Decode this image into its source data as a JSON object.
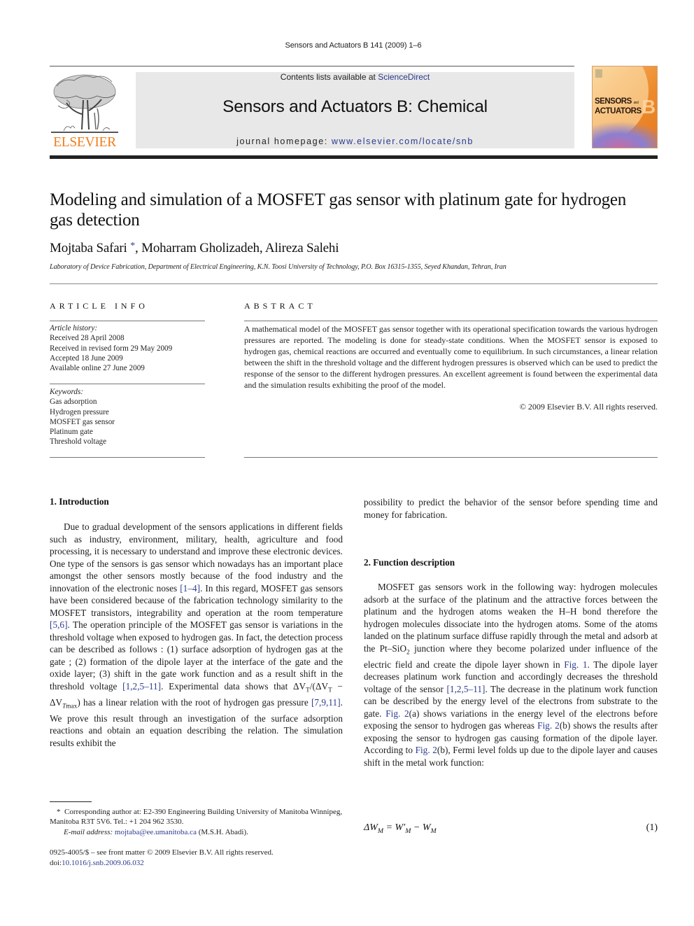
{
  "running_head": "Sensors and Actuators B 141 (2009) 1–6",
  "masthead": {
    "publisher": "ELSEVIER",
    "contents_prefix": "Contents lists available at ",
    "contents_link": "ScienceDirect",
    "journal_title": "Sensors and Actuators B: Chemical",
    "homepage_prefix": "journal homepage: ",
    "homepage_link": "www.elsevier.com/locate/snb",
    "cover": {
      "line1": "SENSORS",
      "and": "and",
      "line2": "ACTUATORS",
      "letter": "B"
    },
    "colors": {
      "elsevier_orange": "#f07d1b",
      "link_blue": "#2b3a8f",
      "band_gray": "#e8e8e8"
    }
  },
  "article": {
    "title": "Modeling and simulation of a MOSFET gas sensor with platinum gate for hydrogen gas detection",
    "authors": [
      {
        "name": "Mojtaba Safari",
        "mark": "*"
      },
      {
        "name": "Moharram Gholizadeh"
      },
      {
        "name": "Alireza Salehi"
      }
    ],
    "affiliation": "Laboratory of Device Fabrication, Department of Electrical Engineering, K.N. Toosi University of Technology, P.O. Box 16315-1355, Seyed Khandan, Tehran, Iran"
  },
  "article_info": {
    "heading": "ARTICLE INFO",
    "history_label": "Article history:",
    "history": [
      "Received 28 April 2008",
      "Received in revised form 29 May 2009",
      "Accepted 18 June 2009",
      "Available online 27 June 2009"
    ],
    "keywords_label": "Keywords:",
    "keywords": [
      "Gas adsorption",
      "Hydrogen pressure",
      "MOSFET gas sensor",
      "Platinum gate",
      "Threshold voltage"
    ]
  },
  "abstract": {
    "heading": "ABSTRACT",
    "text": "A mathematical model of the MOSFET gas sensor together with its operational specification towards the various hydrogen pressures are reported. The modeling is done for steady-state conditions. When the MOSFET sensor is exposed to hydrogen gas, chemical reactions are occurred and eventually come to equilibrium. In such circumstances, a linear relation between the shift in the threshold voltage and the different hydrogen pressures is observed which can be used to predict the response of the sensor to the different hydrogen pressures. An excellent agreement is found between the experimental data and the simulation results exhibiting the proof of the model.",
    "copyright": "© 2009 Elsevier B.V. All rights reserved."
  },
  "sections": {
    "intro": {
      "heading": "1.  Introduction",
      "p1": "Due to gradual development of the sensors applications in different fields such as industry, environment, military, health, agriculture and food processing, it is necessary to understand and improve these electronic devices. One type of the sensors is gas sensor which nowadays has an important place amongst the other sensors mostly because of the food industry and the innovation of the electronic noses ",
      "ref1": "[1–4]",
      "p2": ". In this regard, MOSFET gas sensors have been considered because of the fabrication technology similarity to the MOSFET transistors, integrability and operation at the room temperature ",
      "ref2": "[5,6]",
      "p3": ". The operation principle of the MOSFET gas sensor is variations in the threshold voltage when exposed to hydrogen gas. In fact, the detection process can be described as follows : (1) surface adsorption of hydrogen gas at the gate ; (2) formation of the dipole layer at the interface of the gate and the oxide layer; (3) shift in the gate work function and as a result shift in the threshold voltage ",
      "ref3": "[1,2,5–11]",
      "p4": ". Experimental data shows that ",
      "formula": "ΔV",
      "p5": " has a linear relation with the root of hydrogen gas pressure ",
      "ref4": "[7,9,11]",
      "p6": ". We prove this result through an investigation of the surface adsorption reactions and obtain an equation describing the relation. The simulation results exhibit the",
      "continuation": "possibility to predict the behavior of the sensor before spending time and money for fabrication."
    },
    "function": {
      "heading": "2.  Function description",
      "p1": "MOSFET gas sensors work in the following way: hydrogen molecules adsorb at the surface of the platinum and the attractive forces between the platinum and the hydrogen atoms weaken the H–H bond therefore the hydrogen molecules dissociate into the hydrogen atoms. Some of the atoms landed on the platinum surface diffuse rapidly through the metal and adsorb at the Pt–SiO",
      "p2": " junction where they become polarized under influence of the electric field and create the dipole layer shown in ",
      "fig1": "Fig. 1",
      "p3": ". The dipole layer decreases platinum work function and accordingly decreases the threshold voltage of the sensor ",
      "ref1": "[1,2,5–11]",
      "p4": ". The decrease in the platinum work function can be described by the energy level of the electrons from substrate to the gate. ",
      "fig2a": "Fig. 2",
      "p5": "(a) shows variations in the energy level of the electrons before exposing the sensor to hydrogen gas whereas ",
      "fig2b": "Fig. 2",
      "p6": "(b) shows the results after exposing the sensor to hydrogen gas causing formation of the dipole layer. According to ",
      "fig2c": "Fig. 2",
      "p7": "(b), Fermi level folds up due to the dipole layer and causes shift in the metal work function:",
      "equation_lhs": "ΔW",
      "equation_number": "(1)"
    }
  },
  "footnote": {
    "mark": "*",
    "text": "Corresponding author at: E2-390 Engineering Building University of Manitoba Winnipeg, Manitoba R3T 5V6. Tel.: +1 204 962 3530.",
    "email_label": "E-mail address:",
    "email": "mojtaba@ee.umanitoba.ca",
    "email_suffix": " (M.S.H. Abadi)."
  },
  "front_matter": {
    "issn_line": "0925-4005/$ – see front matter © 2009 Elsevier B.V. All rights reserved.",
    "doi_prefix": "doi:",
    "doi": "10.1016/j.snb.2009.06.032"
  }
}
